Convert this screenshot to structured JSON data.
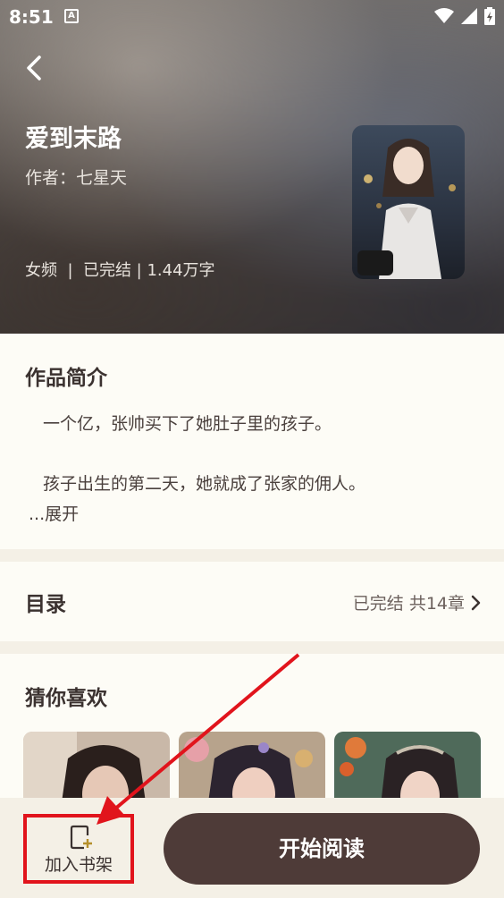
{
  "status_bar": {
    "time": "8:51",
    "a_badge": "A"
  },
  "book": {
    "title": "爱到末路",
    "author": "作者：七星天",
    "meta": "女频  |  已完结 | 1.44万字"
  },
  "intro": {
    "title": "作品简介",
    "paragraph1": "一个亿，张帅买下了她肚子里的孩子。",
    "paragraph2": "孩子出生的第二天，她就成了张家的佣人。",
    "expand_label": "...展开"
  },
  "toc": {
    "title": "目录",
    "status": "已完结 共14章"
  },
  "guess": {
    "title": "猜你喜欢"
  },
  "bottom": {
    "shelf_label": "加入书架",
    "read_label": "开始阅读"
  },
  "colors": {
    "accent_dark": "#4e3b38",
    "annotation_red": "#e1141c",
    "section_bg": "#fdfcf6"
  }
}
